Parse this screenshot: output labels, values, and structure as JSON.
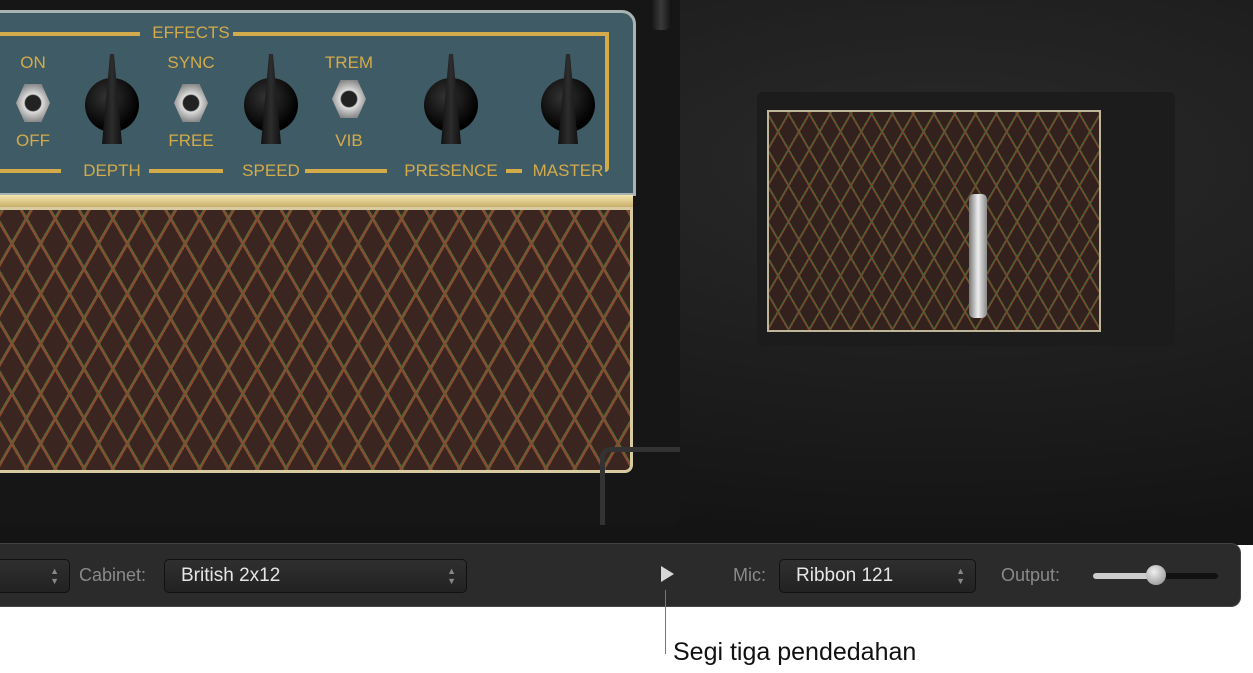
{
  "amp": {
    "effects_label": "EFFECTS",
    "switch1": {
      "top": "ON",
      "bottom": "OFF"
    },
    "switch2": {
      "top": "SYNC",
      "bottom": "FREE"
    },
    "switch3": {
      "top": "TREM",
      "bottom": "VIB"
    },
    "knobs": [
      "DEPTH",
      "SPEED",
      "PRESENCE",
      "MASTER"
    ]
  },
  "bar": {
    "cabinet_label": "Cabinet:",
    "cabinet_value": "British 2x12",
    "mic_label": "Mic:",
    "mic_value": "Ribbon 121",
    "output_label": "Output:",
    "output_level": 0.5
  },
  "annotation": "Segi tiga pendedahan",
  "colors": {
    "panel": "#3f5b65",
    "gold": "#d4ab4a",
    "bar": "#2b2b2b"
  }
}
